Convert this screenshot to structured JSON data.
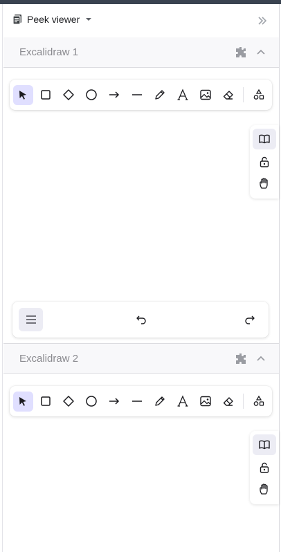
{
  "peek": {
    "title": "Peek viewer"
  },
  "sections": [
    {
      "title": "Excalidraw 1"
    },
    {
      "title": "Excalidraw 2"
    }
  ],
  "tools": [
    {
      "name": "selection-tool",
      "icon": "cursor-icon",
      "active": true
    },
    {
      "name": "rectangle-tool",
      "icon": "square-icon"
    },
    {
      "name": "diamond-tool",
      "icon": "diamond-icon"
    },
    {
      "name": "ellipse-tool",
      "icon": "circle-icon"
    },
    {
      "name": "arrow-tool",
      "icon": "arrow-right-icon"
    },
    {
      "name": "line-tool",
      "icon": "line-icon"
    },
    {
      "name": "draw-tool",
      "icon": "pencil-icon"
    },
    {
      "name": "text-tool",
      "icon": "text-icon"
    },
    {
      "name": "image-tool",
      "icon": "image-icon"
    },
    {
      "name": "eraser-tool",
      "icon": "eraser-icon"
    },
    {
      "name": "more-shapes-tool",
      "icon": "shapes-icon"
    }
  ],
  "side_tools": [
    {
      "name": "library-button",
      "icon": "book-icon",
      "active": true
    },
    {
      "name": "lock-button",
      "icon": "unlock-icon"
    },
    {
      "name": "hand-button",
      "icon": "hand-icon"
    }
  ],
  "colors": {
    "accent": "#e0dfff",
    "icon": "#1b1b1f",
    "muted": "#8a8a8f",
    "topbar": "#3a4350"
  }
}
